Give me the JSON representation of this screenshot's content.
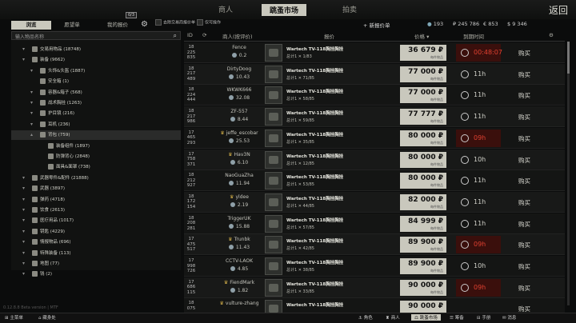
{
  "top": {
    "left": "商人",
    "active": "跳蚤市场",
    "right": "拍卖",
    "back": "返回"
  },
  "tabs": {
    "browse": "浏览",
    "wishlist": "愿望单",
    "my_offers": "我的报价",
    "badge": "0/3"
  },
  "auto_items": [
    "去除交易商报价单",
    "仅可操作"
  ],
  "add_offer": "+ 新报价单",
  "wallet": {
    "gp": "193",
    "rub": "₽ 245 786",
    "eur": "€ 853",
    "usd": "$ 9 346"
  },
  "search": {
    "placeholder": "输入物品名称"
  },
  "categories": [
    {
      "label": "交易用物品 (18748)",
      "depth": 0,
      "chev": "▾"
    },
    {
      "label": "装备 (9662)",
      "depth": 0,
      "chev": "▾"
    },
    {
      "label": "头饰&头盔 (1887)",
      "depth": 1,
      "chev": "▾"
    },
    {
      "label": "安全箱 (1)",
      "depth": 1,
      "chev": ""
    },
    {
      "label": "容器&箱子 (568)",
      "depth": 1,
      "chev": "▾"
    },
    {
      "label": "战术胸挂 (1263)",
      "depth": 1,
      "chev": "▾"
    },
    {
      "label": "护目镜 (216)",
      "depth": 1,
      "chev": "▾"
    },
    {
      "label": "耳机 (236)",
      "depth": 1,
      "chev": "▾"
    },
    {
      "label": "背包 (759)",
      "depth": 1,
      "chev": "▴",
      "selected": true
    },
    {
      "label": "装备组件 (1897)",
      "depth": 2,
      "chev": ""
    },
    {
      "label": "防弹背心 (2848)",
      "depth": 2,
      "chev": ""
    },
    {
      "label": "面具&面罩 (738)",
      "depth": 2,
      "chev": ""
    },
    {
      "label": "武器零件&配件 (21888)",
      "depth": 0,
      "chev": "▾"
    },
    {
      "label": "武器 (3897)",
      "depth": 0,
      "chev": "▾"
    },
    {
      "label": "弹药 (4718)",
      "depth": 0,
      "chev": "▾"
    },
    {
      "label": "饮食 (2613)",
      "depth": 0,
      "chev": "▾"
    },
    {
      "label": "医疗用品 (1017)",
      "depth": 0,
      "chev": "▾"
    },
    {
      "label": "钥匙 (4229)",
      "depth": 0,
      "chev": "▾"
    },
    {
      "label": "情报物品 (696)",
      "depth": 0,
      "chev": "▾"
    },
    {
      "label": "特殊装备 (113)",
      "depth": 0,
      "chev": "▾"
    },
    {
      "label": "地图 (77)",
      "depth": 0,
      "chev": "▾"
    },
    {
      "label": "钱 (2)",
      "depth": 0,
      "chev": "▾"
    }
  ],
  "columns": {
    "id": "ID",
    "seller": "商人(按评价)",
    "offer": "报价",
    "price": "价格 ▾",
    "expire": "到期时间"
  },
  "rows": [
    {
      "id": "18\n225\n835",
      "name": "Fence",
      "rep": "0.2",
      "item": "Wartech TV-118胸挂胸挂",
      "qty": "总计1 ✕ 1/83",
      "price": "36 679 ₽",
      "sub": "每件物品",
      "time": "00:48:07",
      "red": true,
      "buy": "购买",
      "crown": false
    },
    {
      "id": "18\n217\n489",
      "name": "DirtyDoog",
      "rep": "10.43",
      "item": "Wartech TV-118胸挂胸挂",
      "qty": "总计1 ✕ 71/85",
      "price": "77 000 ₽",
      "sub": "每件物品",
      "time": "11h",
      "red": false,
      "buy": "购买",
      "crown": false
    },
    {
      "id": "18\n224\n444",
      "name": "WKWK666",
      "rep": "32.08",
      "item": "Wartech TV-118胸挂胸挂",
      "qty": "总计1 ✕ 58/85",
      "price": "77 000 ₽",
      "sub": "每件物品",
      "time": "11h",
      "red": false,
      "buy": "购买",
      "crown": false
    },
    {
      "id": "18\n217\n986",
      "name": "ZF-557",
      "rep": "8.44",
      "item": "Wartech TV-118胸挂胸挂",
      "qty": "总计1 ✕ 59/85",
      "price": "77 777 ₽",
      "sub": "每件物品",
      "time": "11h",
      "red": false,
      "buy": "购买",
      "crown": false
    },
    {
      "id": "17\n465\n293",
      "name": "jeffe_escobar",
      "rep": "25.53",
      "item": "Wartech TV-118胸挂胸挂",
      "qty": "总计1 ✕ 35/85",
      "price": "80 000 ₽",
      "sub": "每件物品",
      "time": "09h",
      "red": true,
      "buy": "购买",
      "crown": true
    },
    {
      "id": "17\n758\n371",
      "name": "Hav3N",
      "rep": "6.10",
      "item": "Wartech TV-118胸挂胸挂",
      "qty": "总计1 ✕ 12/85",
      "price": "80 000 ₽",
      "sub": "每件物品",
      "time": "10h",
      "red": false,
      "buy": "购买",
      "crown": true
    },
    {
      "id": "18\n212\n927",
      "name": "NaoGuaZha",
      "rep": "11.94",
      "item": "Wartech TV-118胸挂胸挂",
      "qty": "总计1 ✕ 53/85",
      "price": "80 000 ₽",
      "sub": "每件物品",
      "time": "11h",
      "red": false,
      "buy": "购买",
      "crown": false
    },
    {
      "id": "18\n172\n154",
      "name": "yldee",
      "rep": "2.19",
      "item": "Wartech TV-118胸挂胸挂",
      "qty": "总计1 ✕ 44/85",
      "price": "82 000 ₽",
      "sub": "每件物品",
      "time": "11h",
      "red": false,
      "buy": "购买",
      "crown": true
    },
    {
      "id": "18\n208\n281",
      "name": "TriggerUK",
      "rep": "15.88",
      "item": "Wartech TV-118胸挂胸挂",
      "qty": "总计1 ✕ 57/85",
      "price": "84 999 ₽",
      "sub": "每件物品",
      "time": "11h",
      "red": false,
      "buy": "购买",
      "crown": false
    },
    {
      "id": "17\n475\n517",
      "name": "Trunbk",
      "rep": "11.43",
      "item": "Wartech TV-118胸挂胸挂",
      "qty": "总计1 ✕ 42/85",
      "price": "89 900 ₽",
      "sub": "每件物品",
      "time": "09h",
      "red": true,
      "buy": "购买",
      "crown": true
    },
    {
      "id": "17\n998\n726",
      "name": "CCTV-LAOK",
      "rep": "4.85",
      "item": "Wartech TV-118胸挂胸挂",
      "qty": "总计1 ✕ 38/85",
      "price": "89 900 ₽",
      "sub": "每件物品",
      "time": "10h",
      "red": false,
      "buy": "购买",
      "crown": false
    },
    {
      "id": "17\n686\n115",
      "name": "FiendMark",
      "rep": "1.82",
      "item": "Wartech TV-118胸挂胸挂",
      "qty": "总计1 ✕ 33/85",
      "price": "90 000 ₽",
      "sub": "每件物品",
      "time": "09h",
      "red": true,
      "buy": "购买",
      "crown": true
    },
    {
      "id": "18\n075",
      "name": "vulture-zhang",
      "rep": "",
      "item": "Wartech TV-118胸挂胸挂",
      "qty": "",
      "price": "90 000 ₽",
      "sub": "",
      "time": "",
      "red": false,
      "buy": "购买",
      "crown": true
    }
  ],
  "bottom": [
    "主菜单",
    "藏身处",
    "角色",
    "商人",
    "跳蚤市场",
    "筹备",
    "手册",
    "消息"
  ],
  "version": "0.12.8.8 Beta version | MTF"
}
